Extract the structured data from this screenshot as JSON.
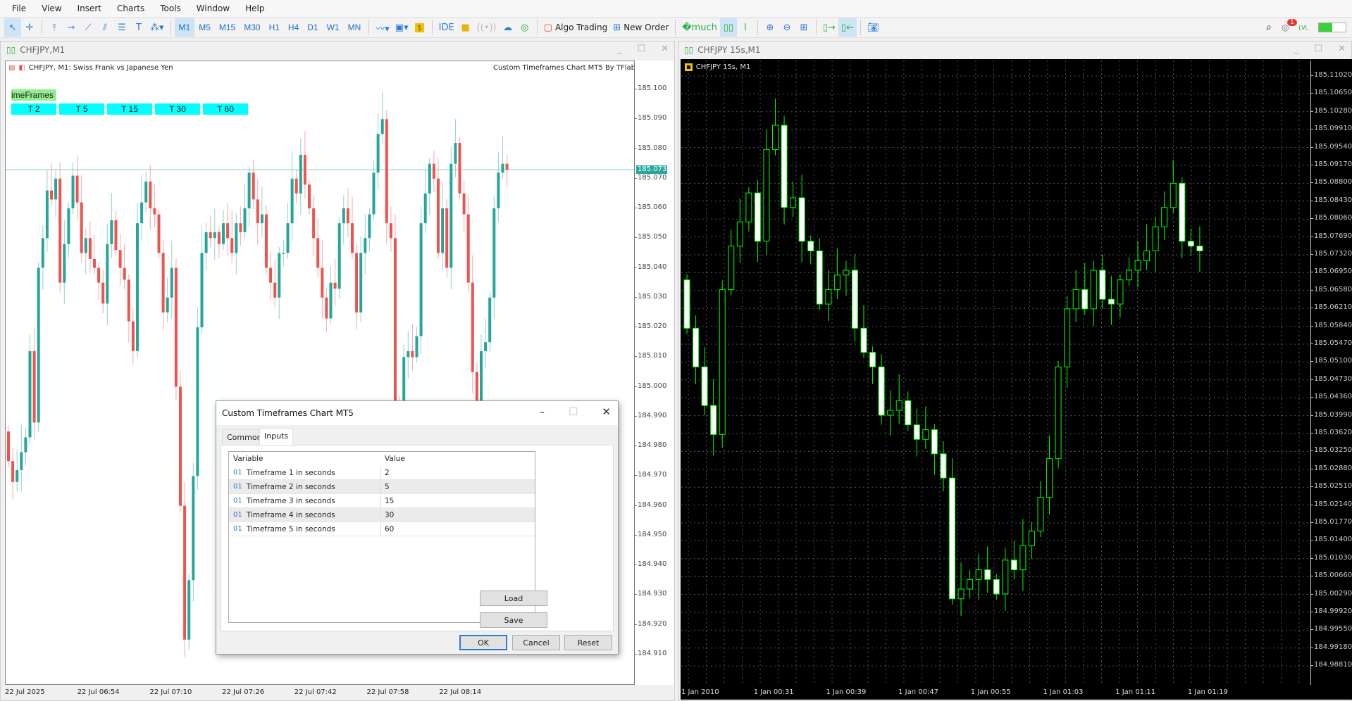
{
  "menu": [
    "File",
    "View",
    "Insert",
    "Charts",
    "Tools",
    "Window",
    "Help"
  ],
  "toolbar": {
    "timeframes": [
      "M1",
      "M5",
      "M15",
      "M30",
      "H1",
      "H4",
      "D1",
      "W1",
      "MN"
    ],
    "selected_timeframe": "M1",
    "ide": "IDE",
    "algo_trading": "Algo Trading",
    "new_order": "New Order",
    "notification_count": "1",
    "lvl": "LVL"
  },
  "left_window": {
    "title": "CHFJPY,M1",
    "chart_info": "CHFJPY, M1:  Swiss Frank vs Japanese Yen",
    "indicator_label": "Custom Timeframes Chart MT5 By TFlab",
    "timeframes_label": "imeFrames",
    "tf_buttons": [
      "T 2",
      "T 5",
      "T 15",
      "T 30",
      "T 60"
    ],
    "current_price": "185.073"
  },
  "right_window": {
    "title": "CHFJPY 15s,M1",
    "chart_info": "CHFJPY 15s, M1"
  },
  "dialog": {
    "title": "Custom Timeframes Chart MT5",
    "tabs": [
      "Common",
      "Inputs"
    ],
    "active_tab": "Inputs",
    "columns": [
      "Variable",
      "Value"
    ],
    "rows": [
      {
        "type": "01",
        "variable": "Timeframe 1 in seconds",
        "value": "2"
      },
      {
        "type": "01",
        "variable": "Timeframe 2 in seconds",
        "value": "5"
      },
      {
        "type": "01",
        "variable": "Timeframe 3 in seconds",
        "value": "15"
      },
      {
        "type": "01",
        "variable": "Timeframe 4 in seconds",
        "value": "30"
      },
      {
        "type": "01",
        "variable": "Timeframe 5 in seconds",
        "value": "60"
      }
    ],
    "load": "Load",
    "save": "Save",
    "ok": "OK",
    "cancel": "Cancel",
    "reset": "Reset"
  },
  "chart_data": [
    {
      "type": "candlestick",
      "symbol": "CHFJPY",
      "timeframe": "M1",
      "ylim": [
        184.905,
        185.105
      ],
      "y_ticks": [
        "185.100",
        "185.090",
        "185.080",
        "185.070",
        "185.060",
        "185.050",
        "185.040",
        "185.030",
        "185.020",
        "185.010",
        "185.000",
        "184.990",
        "184.980",
        "184.970",
        "184.960",
        "184.950",
        "184.940",
        "184.930",
        "184.920",
        "184.910"
      ],
      "x_ticks": [
        "22 Jul 2025",
        "22 Jul 06:54",
        "22 Jul 07:10",
        "22 Jul 07:26",
        "22 Jul 07:42",
        "22 Jul 07:58",
        "22 Jul 08:14"
      ],
      "first_open": 184.985,
      "closes": [
        184.975,
        184.968,
        184.972,
        184.978,
        184.983,
        185.012,
        184.988,
        185.04,
        185.05,
        185.066,
        185.063,
        185.07,
        185.035,
        185.048,
        185.06,
        185.071,
        185.062,
        185.045,
        185.05,
        185.043,
        185.04,
        185.035,
        185.028,
        185.048,
        185.056,
        185.046,
        185.04,
        185.036,
        185.022,
        185.012,
        185.055,
        185.062,
        185.069,
        185.06,
        185.058,
        185.045,
        185.025,
        185.03,
        185.04,
        185.0,
        184.96,
        184.915,
        184.935,
        184.97,
        185.02,
        185.045,
        185.052,
        185.05,
        185.052,
        185.048,
        185.055,
        185.05,
        185.045,
        185.055,
        185.052,
        185.06,
        185.072,
        185.063,
        185.055,
        185.058,
        185.04,
        185.035,
        185.03,
        185.045,
        185.045,
        185.055,
        185.07,
        185.065,
        185.078,
        185.068,
        185.06,
        185.05,
        185.04,
        185.03,
        185.023,
        185.035,
        185.033,
        185.055,
        185.06,
        185.055,
        185.045,
        185.025,
        185.045,
        185.05,
        185.058,
        185.072,
        185.085,
        185.09,
        185.055,
        185.05,
        184.995,
        184.99,
        185.01,
        185.012,
        185.01,
        185.017,
        185.055,
        185.065,
        185.075,
        185.07,
        185.045,
        185.06,
        185.04,
        185.075,
        185.082,
        185.065,
        185.058,
        185.035,
        185.005,
        184.995,
        185.012,
        185.015,
        185.03,
        185.06,
        185.072,
        185.075,
        185.073
      ],
      "colors": {
        "bull": "#26a69a",
        "bear": "#ef5350"
      }
    },
    {
      "type": "candlestick",
      "symbol": "CHFJPY 15s",
      "timeframe": "M1",
      "ylim": [
        184.9881,
        185.1102
      ],
      "y_ticks": [
        "185.11020",
        "185.10650",
        "185.10280",
        "185.09910",
        "185.09540",
        "185.09170",
        "185.08800",
        "185.08430",
        "185.08060",
        "185.07690",
        "185.07320",
        "185.06950",
        "185.06580",
        "185.06210",
        "185.05840",
        "185.05470",
        "185.05100",
        "185.04730",
        "185.04360",
        "185.03990",
        "185.03620",
        "185.03250",
        "185.02880",
        "185.02510",
        "185.02140",
        "185.01770",
        "185.01400",
        "185.01030",
        "185.00660",
        "185.00290",
        "184.99920",
        "184.99550",
        "184.99180",
        "184.98810"
      ],
      "x_ticks": [
        "1 Jan 2010",
        "1 Jan 00:31",
        "1 Jan 00:39",
        "1 Jan 00:47",
        "1 Jan 00:55",
        "1 Jan 01:03",
        "1 Jan 01:11",
        "1 Jan 01:19"
      ],
      "first_open": 185.068,
      "closes": [
        185.058,
        185.05,
        185.042,
        185.036,
        185.066,
        185.075,
        185.08,
        185.086,
        185.076,
        185.095,
        185.1,
        185.083,
        185.085,
        185.076,
        185.074,
        185.063,
        185.066,
        185.069,
        185.07,
        185.058,
        185.053,
        185.05,
        185.04,
        185.041,
        185.043,
        185.038,
        185.035,
        185.037,
        185.032,
        185.027,
        185.002,
        185.004,
        185.006,
        185.008,
        185.006,
        185.003,
        185.01,
        185.008,
        185.013,
        185.016,
        185.023,
        185.031,
        185.05,
        185.062,
        185.066,
        185.062,
        185.07,
        185.064,
        185.063,
        185.068,
        185.07,
        185.072,
        185.074,
        185.079,
        185.083,
        185.088,
        185.076,
        185.075,
        185.074
      ],
      "grid": true,
      "colors": {
        "bull": "#00ff00",
        "bear": "#ffffff"
      }
    }
  ]
}
